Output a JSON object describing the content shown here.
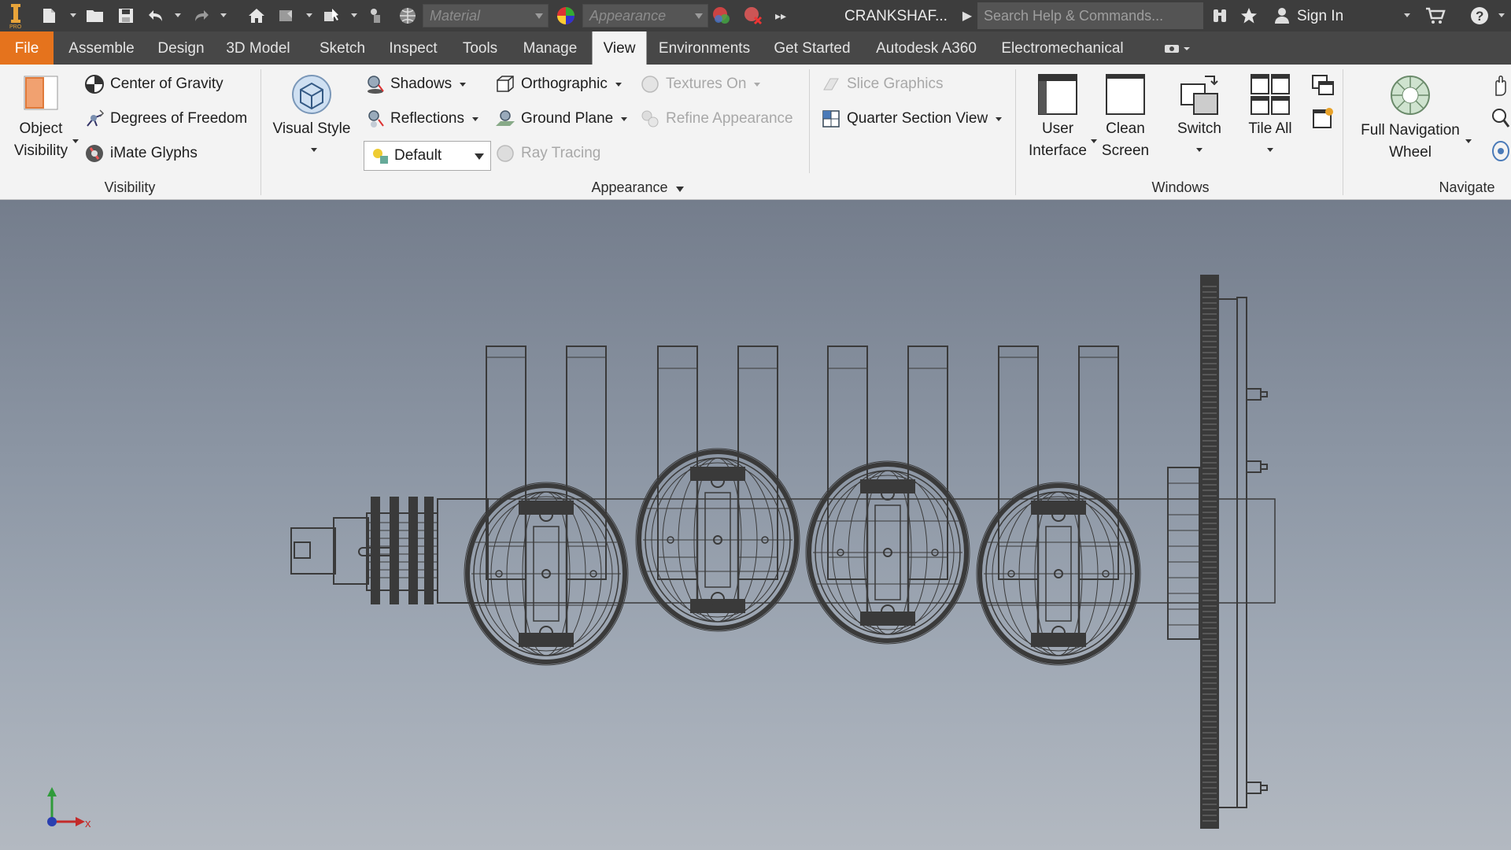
{
  "titlebar": {
    "material_placeholder": "Material",
    "appearance_placeholder": "Appearance",
    "document_title": "CRANKSHAF...",
    "search_placeholder": "Search Help & Commands...",
    "sign_in": "Sign In"
  },
  "tabs": [
    "File",
    "Assemble",
    "Design",
    "3D Model",
    "Sketch",
    "Inspect",
    "Tools",
    "Manage",
    "View",
    "Environments",
    "Get Started",
    "Autodesk A360",
    "Electromechanical"
  ],
  "active_tab": "View",
  "ribbon": {
    "visibility": {
      "title": "Visibility",
      "object_visibility_line1": "Object",
      "object_visibility_line2": "Visibility",
      "center_of_gravity": "Center of Gravity",
      "degrees_of_freedom": "Degrees of Freedom",
      "imate_glyphs": "iMate Glyphs"
    },
    "appearance": {
      "title": "Appearance",
      "visual_style": "Visual Style",
      "shadows": "Shadows",
      "reflections": "Reflections",
      "style_value": "Default",
      "orthographic": "Orthographic",
      "ground_plane": "Ground Plane",
      "ray_tracing": "Ray Tracing",
      "textures_on": "Textures On",
      "refine_appearance": "Refine Appearance",
      "slice_graphics": "Slice Graphics",
      "quarter_section_view": "Quarter Section View"
    },
    "windows": {
      "title": "Windows",
      "user_interface_line1": "User",
      "user_interface_line2": "Interface",
      "clean_screen_line1": "Clean",
      "clean_screen_line2": "Screen",
      "switch": "Switch",
      "tile_all": "Tile All"
    },
    "navigate": {
      "title": "Navigate",
      "full_nav_wheel_line1": "Full Navigation",
      "full_nav_wheel_line2": "Wheel"
    }
  },
  "viewport": {
    "axis_x": "x",
    "wire_color": "#3a3a3a"
  },
  "colors": {
    "file_tab": "#e5731d",
    "titlebar": "#3d3d3d",
    "ribbon": "#f3f3f3"
  }
}
